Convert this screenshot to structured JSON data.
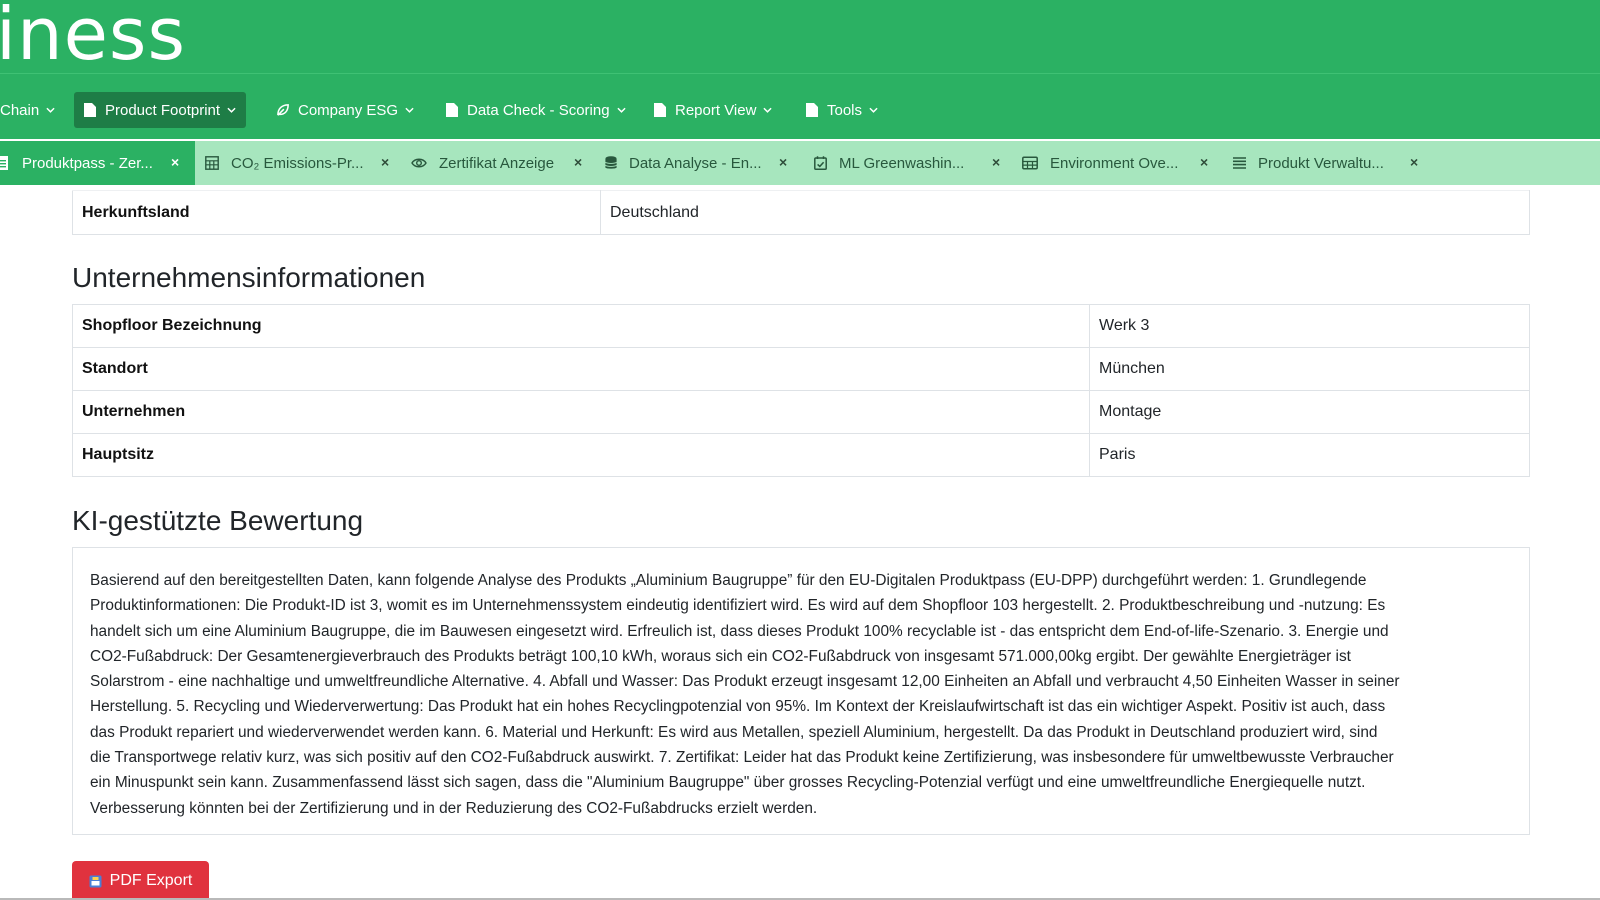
{
  "brand": {
    "title": "iness"
  },
  "nav": {
    "items": [
      {
        "label": "Chain",
        "icon": "none"
      },
      {
        "label": "Product Footprint",
        "icon": "file-icon"
      },
      {
        "label": "Company ESG",
        "icon": "leaf-icon"
      },
      {
        "label": "Data Check - Scoring",
        "icon": "file-icon"
      },
      {
        "label": "Report View",
        "icon": "file-icon"
      },
      {
        "label": "Tools",
        "icon": "file-icon"
      }
    ],
    "active": "Product Footprint"
  },
  "tabs": [
    {
      "label": "Produktpass - Zer...",
      "icon": "list-icon",
      "close": "×"
    },
    {
      "label": "CO₂ Emissions-Pr...",
      "icon": "table-icon",
      "close": "×"
    },
    {
      "label": "Zertifikat Anzeige",
      "icon": "eye-icon",
      "close": "×"
    },
    {
      "label": "Data Analyse - En...",
      "icon": "database-icon",
      "close": "×"
    },
    {
      "label": "ML Greenwashin...",
      "icon": "calendar-check-icon",
      "close": "×"
    },
    {
      "label": "Environment Ove...",
      "icon": "grid-icon",
      "close": "×"
    },
    {
      "label": "Produkt Verwaltu...",
      "icon": "list-icon",
      "close": "×"
    }
  ],
  "top_row": {
    "key": "Herkunftsland",
    "value": "Deutschland"
  },
  "company_section": {
    "title": "Unternehmensinformationen",
    "rows": [
      {
        "key": "Shopfloor Bezeichnung",
        "value": "Werk 3"
      },
      {
        "key": "Standort",
        "value": "München"
      },
      {
        "key": "Unternehmen",
        "value": "Montage"
      },
      {
        "key": "Hauptsitz",
        "value": "Paris"
      }
    ]
  },
  "ai_section": {
    "title": "KI-gestützte Bewertung",
    "lines": [
      "Basierend auf den bereitgestellten Daten, kann folgende Analyse des Produkts „Aluminium Baugruppe” für den EU-Digitalen Produktpass (EU-DPP) durchgeführt werden: 1. Grundlegende",
      "Produktinformationen: Die Produkt-ID ist 3, womit es im Unternehmenssystem eindeutig identifiziert wird. Es wird auf dem Shopfloor 103 hergestellt. 2. Produktbeschreibung und -nutzung: Es",
      "handelt sich um eine Aluminium Baugruppe, die im Bauwesen eingesetzt wird. Erfreulich ist, dass dieses Produkt 100% recyclable ist - das entspricht dem End-of-life-Szenario. 3. Energie und",
      "CO2-Fußabdruck: Der Gesamtenergieverbrauch des Produkts beträgt 100,10 kWh, woraus sich ein CO2-Fußabdruck von insgesamt 571.000,00kg ergibt. Der gewählte Energieträger ist",
      "Solarstrom - eine nachhaltige und umweltfreundliche Alternative. 4. Abfall und Wasser: Das Produkt erzeugt insgesamt 12,00 Einheiten an Abfall und verbraucht 4,50 Einheiten Wasser in seiner",
      "Herstellung. 5. Recycling und Wiederverwertung: Das Produkt hat ein hohes Recyclingpotenzial von 95%. Im Kontext der Kreislaufwirtschaft ist das ein wichtiger Aspekt. Positiv ist auch, dass",
      "das Produkt repariert und wiederverwendet werden kann. 6. Material und Herkunft: Es wird aus Metallen, speziell Aluminium, hergestellt. Da das Produkt in Deutschland produziert wird, sind",
      "die Transportwege relativ kurz, was sich positiv auf den CO2-Fußabdruck auswirkt. 7. Zertifikat: Leider hat das Produkt keine Zertifizierung, was insbesondere für umweltbewusste Verbraucher",
      "ein Minuspunkt sein kann. Zusammenfassend lässt sich sagen, dass die \"Aluminium Baugruppe\" über grosses Recycling-Potenzial verfügt und eine umweltfreundliche Energiequelle nutzt.",
      "Verbesserung könnten bei der Zertifizierung und in der Reduzierung des CO2-Fußabdrucks erzielt werden."
    ]
  },
  "pdf_button": {
    "label": "PDF Export",
    "icon": "pdf-icon"
  },
  "colors": {
    "brand_green": "#2bb163",
    "active_nav": "#1e7d46",
    "tab_strip": "#a7e6be",
    "pdf_red": "#e0323e"
  }
}
